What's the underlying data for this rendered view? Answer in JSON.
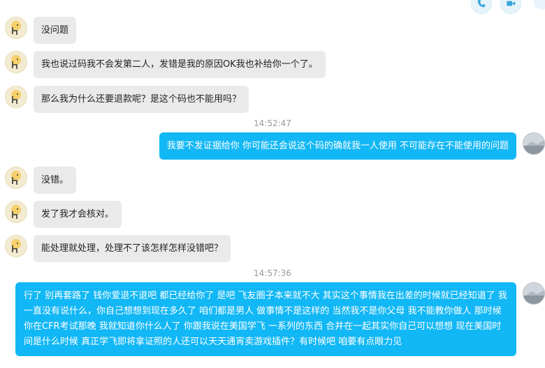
{
  "messages": [
    {
      "side": "left",
      "text": "没问题"
    },
    {
      "side": "left",
      "text": "我也说过码我不会发第二人，发错是我的原因OK我也补给你一个了。"
    },
    {
      "side": "left",
      "text": "那么我为什么还要退款呢？是这个码也不能用吗？"
    },
    {
      "type": "time",
      "text": "14:52:47"
    },
    {
      "side": "right",
      "text": "我要不发证据给你 你可能还会说这个码的确就我一人使用 不可能存在不能使用的问题"
    },
    {
      "side": "left",
      "text": "没错。"
    },
    {
      "side": "left",
      "text": "发了我才会核对。"
    },
    {
      "side": "left",
      "text": "能处理就处理，处理不了该怎样怎样没错吧？"
    },
    {
      "type": "time",
      "text": "14:57:36"
    },
    {
      "side": "right",
      "text": "行了 别再套路了 钱你爱退不退吧 都已经给你了 是吧 飞友圈子本来就不大 其实这个事情我在出差的时候就已经知道了 我一直没有说什么，你自己想想到现在多久了 咱们都是男人 做事情不是这样的 当然我不是你父母 我不能教你做人 那时候你在CFR考试那晚 我就知道你什么人了 你跟我说在美国学飞 一系列的东西 合并在一起其实你自己可以想想 现在美国时间是什么时候 真正学飞即将拿证照的人还可以天天通宵卖游戏插件？有时候吧 咱要有点眼力见"
    }
  ],
  "icons": {
    "top_left_action": "phone-icon",
    "top_right_action": "video-icon"
  },
  "colors": {
    "sent_bubble": "#12b7f5",
    "received_bubble": "#eaeaea",
    "timestamp": "#9a9a9a"
  }
}
